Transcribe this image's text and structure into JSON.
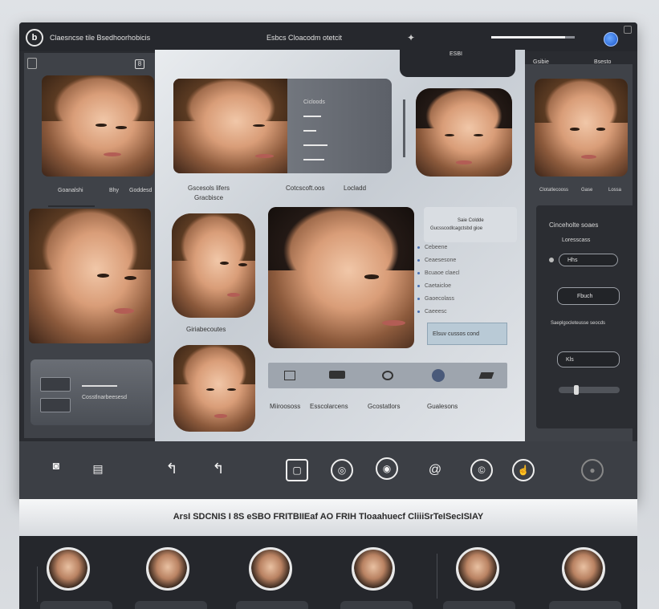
{
  "titlebar": {
    "app_title": "Claesncse tile Bsedhoorhobicis",
    "center_title": "Esbcs Cloacodm otetcit",
    "tab_label": "ESBI",
    "progress_fraction": 0.88
  },
  "left_col": {
    "top_captions": [
      "Goanalshi",
      "Bhy",
      "Goddesd"
    ],
    "card_label": "Cosstlnarbeesesd"
  },
  "center": {
    "hero_card_label": "Cicloods",
    "caption_left": "Gscesols lifers",
    "caption_left_sub": "Gracbisce",
    "caption_mid": "Cotcscoft.oos",
    "caption_right": "Locladd",
    "small_face_label": "Giriabecoutes",
    "info_box_title": "Saie Coldde",
    "info_box_sub": "Gucsscodlcagctsbd gioe",
    "list_items": [
      "Cebeene",
      "Ceaesesone",
      "Bcuaoe claecl",
      "Caetaicloe",
      "Gaoecolass",
      "Caeeesc"
    ],
    "action_label": "Elsuv cussos cond",
    "bottom_labels": [
      "Miiroososs",
      "Esscolarcens",
      "Gcostatlors",
      "Gualesons"
    ]
  },
  "right_col": {
    "captions": [
      "Clotatlecooss",
      "Gase",
      "Lossa"
    ]
  },
  "controls": {
    "title": "Cinceholte soaes",
    "subtitle": "Loresscass",
    "field_1": "Hhs",
    "field_2": "Fbuch",
    "section_label": "Saeplgocleteusse seocds",
    "field_3": "Kls",
    "slider_value": 0.25
  },
  "caption": "ArsI SDCNIS I 8S eSBO FRITBIIEaf AO FRIH Tloaahuecf CliiiSrTeISecISIAY",
  "icons": {
    "logo": "logo-icon",
    "star": "sparkle-icon",
    "globe": "globe-icon"
  },
  "colors": {
    "accent_blue": "#1a55c9",
    "panel_dark": "#2a2c31"
  }
}
